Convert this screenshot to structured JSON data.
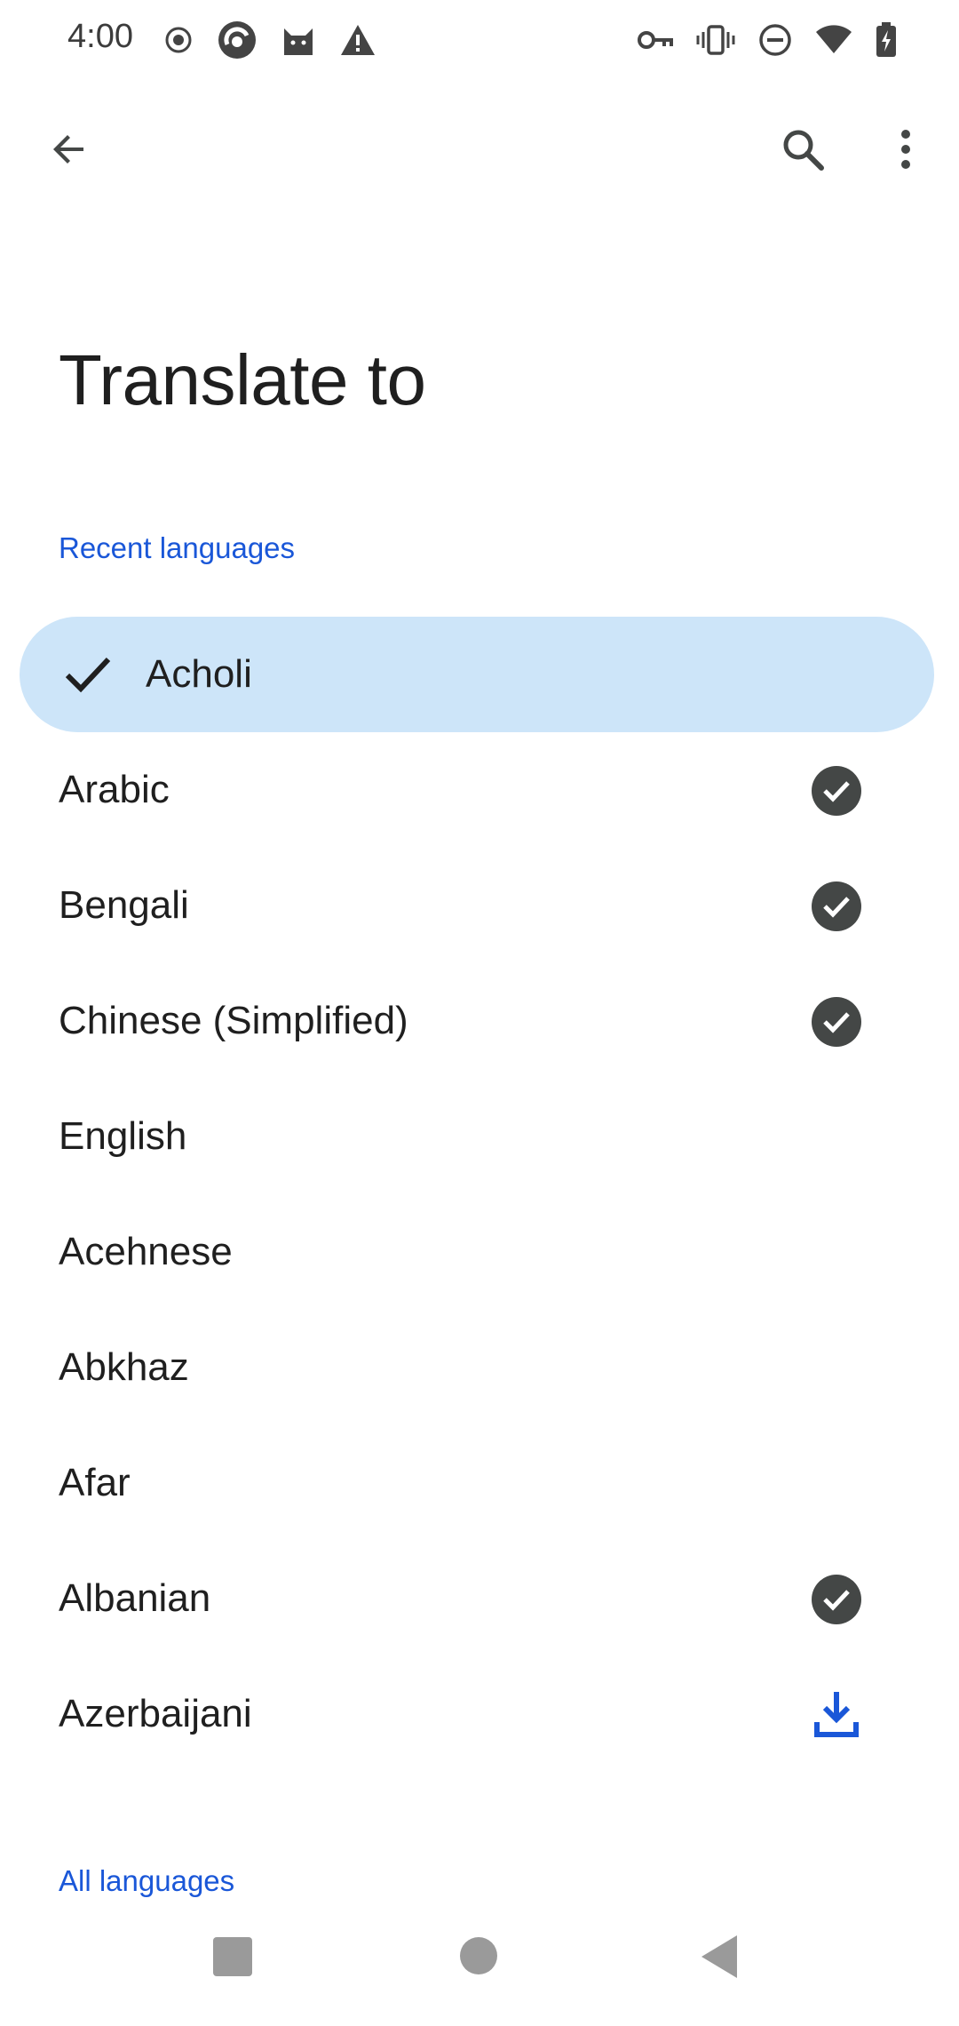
{
  "status_bar": {
    "time": "4:00",
    "left_icons": [
      "record-icon",
      "app-icon",
      "cat-icon",
      "warning-icon"
    ],
    "right_icons": [
      "vpn-key-icon",
      "vibrate-icon",
      "dnd-icon",
      "wifi-icon",
      "battery-charging-icon"
    ]
  },
  "app_bar": {
    "back_icon": "arrow-back-icon",
    "search_icon": "search-icon",
    "more_icon": "more-vert-icon"
  },
  "page": {
    "title": "Translate to"
  },
  "sections": {
    "recent": "Recent languages",
    "all": "All languages"
  },
  "languages": [
    {
      "label": "Acholi",
      "selected": true,
      "status": "none"
    },
    {
      "label": "Arabic",
      "selected": false,
      "status": "downloaded"
    },
    {
      "label": "Bengali",
      "selected": false,
      "status": "downloaded"
    },
    {
      "label": "Chinese (Simplified)",
      "selected": false,
      "status": "downloaded"
    },
    {
      "label": "English",
      "selected": false,
      "status": "none"
    },
    {
      "label": "Acehnese",
      "selected": false,
      "status": "none"
    },
    {
      "label": "Abkhaz",
      "selected": false,
      "status": "none"
    },
    {
      "label": "Afar",
      "selected": false,
      "status": "none"
    },
    {
      "label": "Albanian",
      "selected": false,
      "status": "downloaded"
    },
    {
      "label": "Azerbaijani",
      "selected": false,
      "status": "download-available"
    }
  ],
  "colors": {
    "accent": "#1a57d8",
    "selected_background": "#cde5f9",
    "badge": "#444746"
  },
  "nav_bar": {
    "icons": [
      "recents-square-icon",
      "home-circle-icon",
      "back-triangle-icon"
    ]
  }
}
